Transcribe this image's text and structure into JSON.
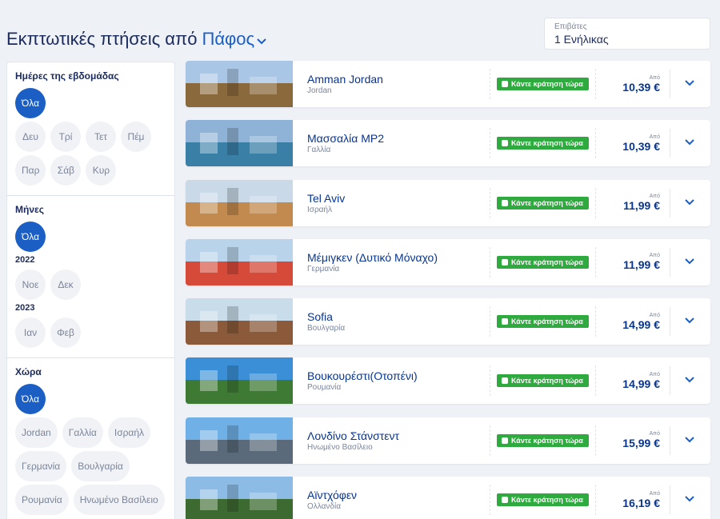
{
  "header": {
    "title": "Εκπτωτικές πτήσεις από",
    "origin": "Πάφος",
    "passengers_label": "Επιβάτες",
    "passengers_value": "1 Ενήλικας"
  },
  "filters": {
    "weekdays": {
      "title": "Ημέρες της εβδομάδας",
      "all": "Όλα",
      "days": [
        "Δευ",
        "Τρί",
        "Τετ",
        "Πέμ",
        "Παρ",
        "Σάβ",
        "Κυρ"
      ]
    },
    "months": {
      "title": "Μήνες",
      "all": "Όλα",
      "year1": "2022",
      "year1_months": [
        "Νοε",
        "Δεκ"
      ],
      "year2": "2023",
      "year2_months": [
        "Ιαν",
        "Φεβ"
      ]
    },
    "countries": {
      "title": "Χώρα",
      "all": "Όλα",
      "items": [
        "Jordan",
        "Γαλλία",
        "Ισραήλ",
        "Γερμανία",
        "Βουλγαρία",
        "Ρουμανία",
        "Ηνωμένο Βασίλειο"
      ]
    }
  },
  "book_label": "Κάντε κράτηση τώρα",
  "from_label": "Από",
  "destinations": [
    {
      "name": "Amman Jordan",
      "country": "Jordan",
      "price": "10,39 €",
      "sky": "#a9c6e6",
      "ground": "#8a6a3c"
    },
    {
      "name": "Μασσαλία MP2",
      "country": "Γαλλία",
      "price": "10,39 €",
      "sky": "#8fb3d6",
      "ground": "#3a7fa6"
    },
    {
      "name": "Tel Aviv",
      "country": "Ισραήλ",
      "price": "11,99 €",
      "sky": "#c9d9e8",
      "ground": "#c28a4e"
    },
    {
      "name": "Μέμιγκεν (Δυτικό Μόναχο)",
      "country": "Γερμανία",
      "price": "11,99 €",
      "sky": "#b8d3ea",
      "ground": "#d64a3a"
    },
    {
      "name": "Sofia",
      "country": "Βουλγαρία",
      "price": "14,99 €",
      "sky": "#c9dcea",
      "ground": "#8a5a3a"
    },
    {
      "name": "Βουκουρέστι(Οτοπένι)",
      "country": "Ρουμανία",
      "price": "14,99 €",
      "sky": "#3a8fd6",
      "ground": "#3f7a35"
    },
    {
      "name": "Λονδίνο Στάνστεντ",
      "country": "Ηνωμένο Βασίλειο",
      "price": "15,99 €",
      "sky": "#6fb0e6",
      "ground": "#5a6a7a"
    },
    {
      "name": "Αϊντχόφεν",
      "country": "Ολλανδία",
      "price": "16,19 €",
      "sky": "#8cbce6",
      "ground": "#3d6a30"
    }
  ]
}
